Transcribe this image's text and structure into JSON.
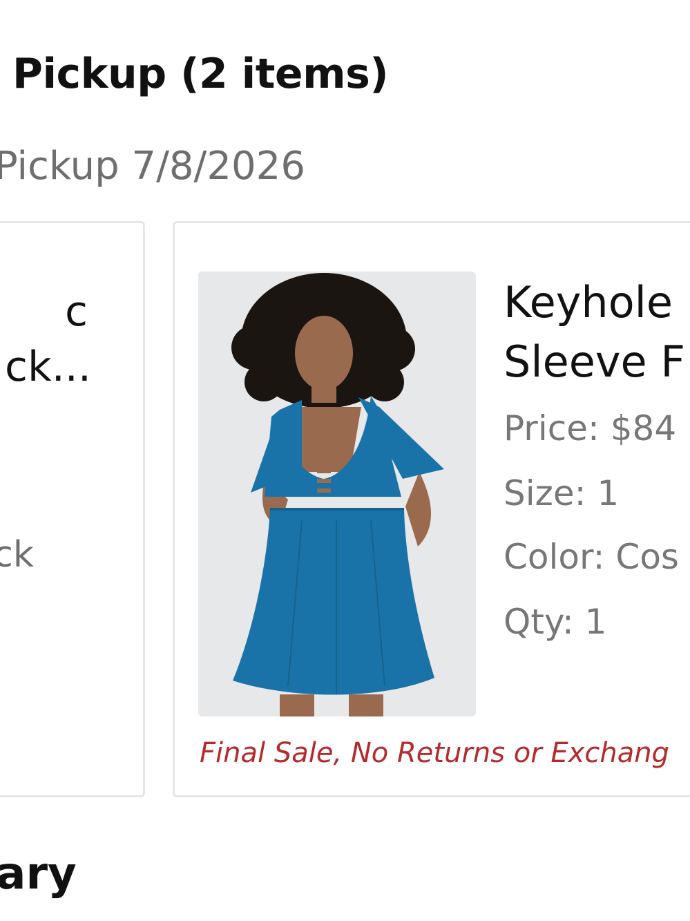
{
  "pickup_section": {
    "title": "Pickup (2 items)",
    "date": "Pickup 7/8/2026"
  },
  "left_item": {
    "name_line1": "c",
    "name_line2": "ck...",
    "color_fragment": "ck"
  },
  "right_item": {
    "title_line1": "Keyhole",
    "title_line2": "Sleeve F",
    "price": "Price: $84",
    "size": "Size: 1",
    "color": "Color: Cos",
    "qty": "Qty: 1",
    "final_sale": "Final Sale, No Returns or Exchang",
    "image_icon": "product-photo-blue-swim-dress"
  },
  "summary": {
    "title": "nmary"
  },
  "colors": {
    "final_sale": "#b52a2a",
    "muted_text": "#6e6e6e",
    "card_border": "#e6e6e6",
    "dress_blue": "#1a73a8"
  }
}
